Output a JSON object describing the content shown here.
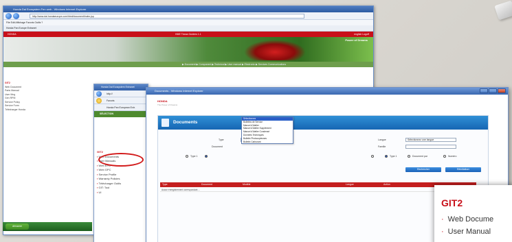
{
  "back_window": {
    "title": "Honda Dai Ecosystem Fen web - Windows Internet Explorer",
    "url": "http://www.dai.hondaeurope.com/html/document/index.jsp",
    "menu": "File   Edit   Affichage   Favoris   Outils   ?",
    "favorites": "Honda Pan Europe Extranet",
    "red_bar_left": "HONDA",
    "red_bar_mid": "HME Tirana Guiders 1.1",
    "red_bar_right": "english  Logoff    ",
    "banner_tag": "Power of Dreams",
    "green_bar": "▶ Document   ▶ Component   ▶ Technical   ▶ User manual   ▶ Electronic   ▶ Services Communications",
    "side_header": "GIT2",
    "side_items": [
      "Web Document",
      "Parts Manual",
      "User Mng",
      "Gen RPM",
      "Service Policy",
      "Service Form",
      "Télécharger Honda"
    ],
    "taskbar_start": "démarrer"
  },
  "middle_window": {
    "title": "Honda Dai Ecosystem Extranet",
    "addr": "http://",
    "fav": "Favoris",
    "favorites_bar": "Honda Pan European Extr.",
    "green_bar": "SÉLECTION",
    "side_header": "GIT2",
    "side_items": [
      "Web Documents",
      "User Manuals",
      "Web EPC",
      "Web GPC",
      "Service Profile",
      "Warranty Policies",
      "Télécharger Outils",
      "GIT: Tool",
      "UI"
    ]
  },
  "front_window": {
    "title": "Documents - Windows Internet Explorer",
    "logo": "HONDA",
    "logo_sub": "The Power of Dreams",
    "panel_title": "Documents",
    "labels": {
      "type": "Type",
      "document": "Document",
      "langue": "Langue",
      "famille": "Famille",
      "opt1": "Type 1",
      "opt2": "Document par",
      "opt3": "Numéro"
    },
    "type_value": "Sélectionnez",
    "langue_value": "Sélectionnez une langue",
    "dropdown_options": [
      "Sélectionnez",
      "Bulletins de Service",
      "Manuel d'Atelier",
      "Manuel d'Atelier Supplément",
      "Manuel d'Atelier Condensé",
      "Données Techniques",
      "Bulletin Photocopieuses",
      "Bulletin Carburant"
    ],
    "buttons": {
      "search": "Rechercher",
      "reset": "Réinitialiser"
    },
    "table_headers": [
      "Type",
      "Document",
      "Modèle",
      "Langue",
      "Action"
    ],
    "table_row": "Aucun enregistrement correspondant ..."
  },
  "zoom_card": {
    "title": "GIT2",
    "items": [
      "Web Docume",
      "User Manual"
    ]
  }
}
